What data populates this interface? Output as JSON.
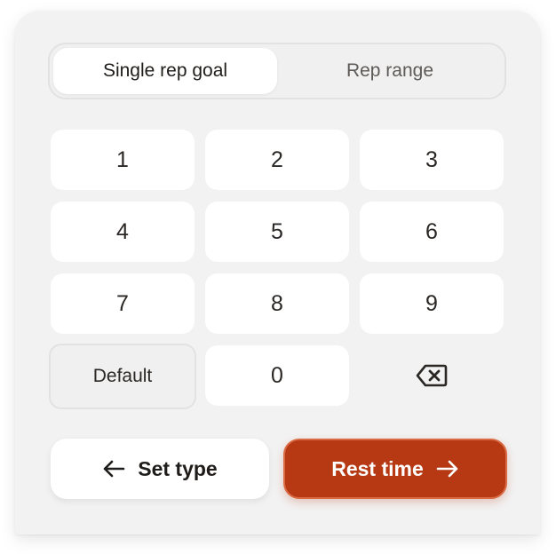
{
  "segmented": {
    "options": [
      {
        "label": "Single rep goal",
        "selected": true
      },
      {
        "label": "Rep range",
        "selected": false
      }
    ]
  },
  "keypad": {
    "keys": [
      "1",
      "2",
      "3",
      "4",
      "5",
      "6",
      "7",
      "8",
      "9",
      "Default",
      "0"
    ],
    "backspace_icon": "backspace-icon"
  },
  "actions": {
    "back_label": "Set type",
    "back_icon": "arrow-left-icon",
    "next_label": "Rest time",
    "next_icon": "arrow-right-icon"
  },
  "colors": {
    "accent": "#b63914",
    "surface": "#f2f2f2",
    "key": "#ffffff"
  }
}
